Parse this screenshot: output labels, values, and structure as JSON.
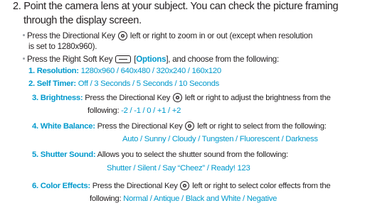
{
  "step": {
    "number": "2.",
    "text_l1": "Point the camera lens at your subject. You can check the picture framing",
    "text_l2": "through the display screen."
  },
  "bullets": {
    "zoom": {
      "l1_a": "Press the Directional Key",
      "l1_b": "left or right to zoom in or out (except when resolution",
      "l2": "is set to 1280x960)."
    },
    "options": {
      "a": "Press the Right Soft Key",
      "bracket_open": "[",
      "label": "Options",
      "b": "], and choose from the following:"
    }
  },
  "items": {
    "resolution": {
      "label": "1. Resolution:",
      "values": [
        "1280x960",
        "640x480",
        "320x240",
        "160x120"
      ]
    },
    "self_timer": {
      "label": "2. Self Timer:",
      "values": [
        "Off",
        "3 Seconds",
        "5 Seconds",
        "10 Seconds"
      ]
    },
    "brightness": {
      "label": "3. Brightness:",
      "l1_a": "Press the Directional Key",
      "l1_b": "left or right to adjust the brightness from the",
      "l2_prefix": "following:",
      "values": [
        "-2",
        "-1",
        "0",
        "+1",
        "+2"
      ]
    },
    "white_balance": {
      "label": "4. White Balance:",
      "l1_a": "Press the Directional Key",
      "l1_b": "left or right to select from the following:",
      "values": [
        "Auto",
        "Sunny",
        "Cloudy",
        "Tungsten",
        "Fluorescent",
        "Darkness"
      ]
    },
    "shutter_sound": {
      "label": "5. Shutter Sound:",
      "l1": "Allows you to select the shutter sound from the following:",
      "values": [
        "Shutter",
        "Silent",
        "Say “Cheez”",
        "Ready! 123"
      ]
    },
    "color_effects": {
      "label": "6. Color Effects:",
      "l1_a": "Press the Directional Key",
      "l1_b": "left or right to select color effects from the",
      "l2_prefix": "following:",
      "values": [
        "Normal",
        "Antique",
        "Black and White",
        "Negative"
      ]
    }
  },
  "separator": " / ",
  "colors": {
    "text": "#231f20",
    "accent": "#0099cc",
    "bullet": "#9aa0a6"
  },
  "icons": {
    "directional_key": "directional-key-icon",
    "soft_key": "right-soft-key-icon"
  }
}
